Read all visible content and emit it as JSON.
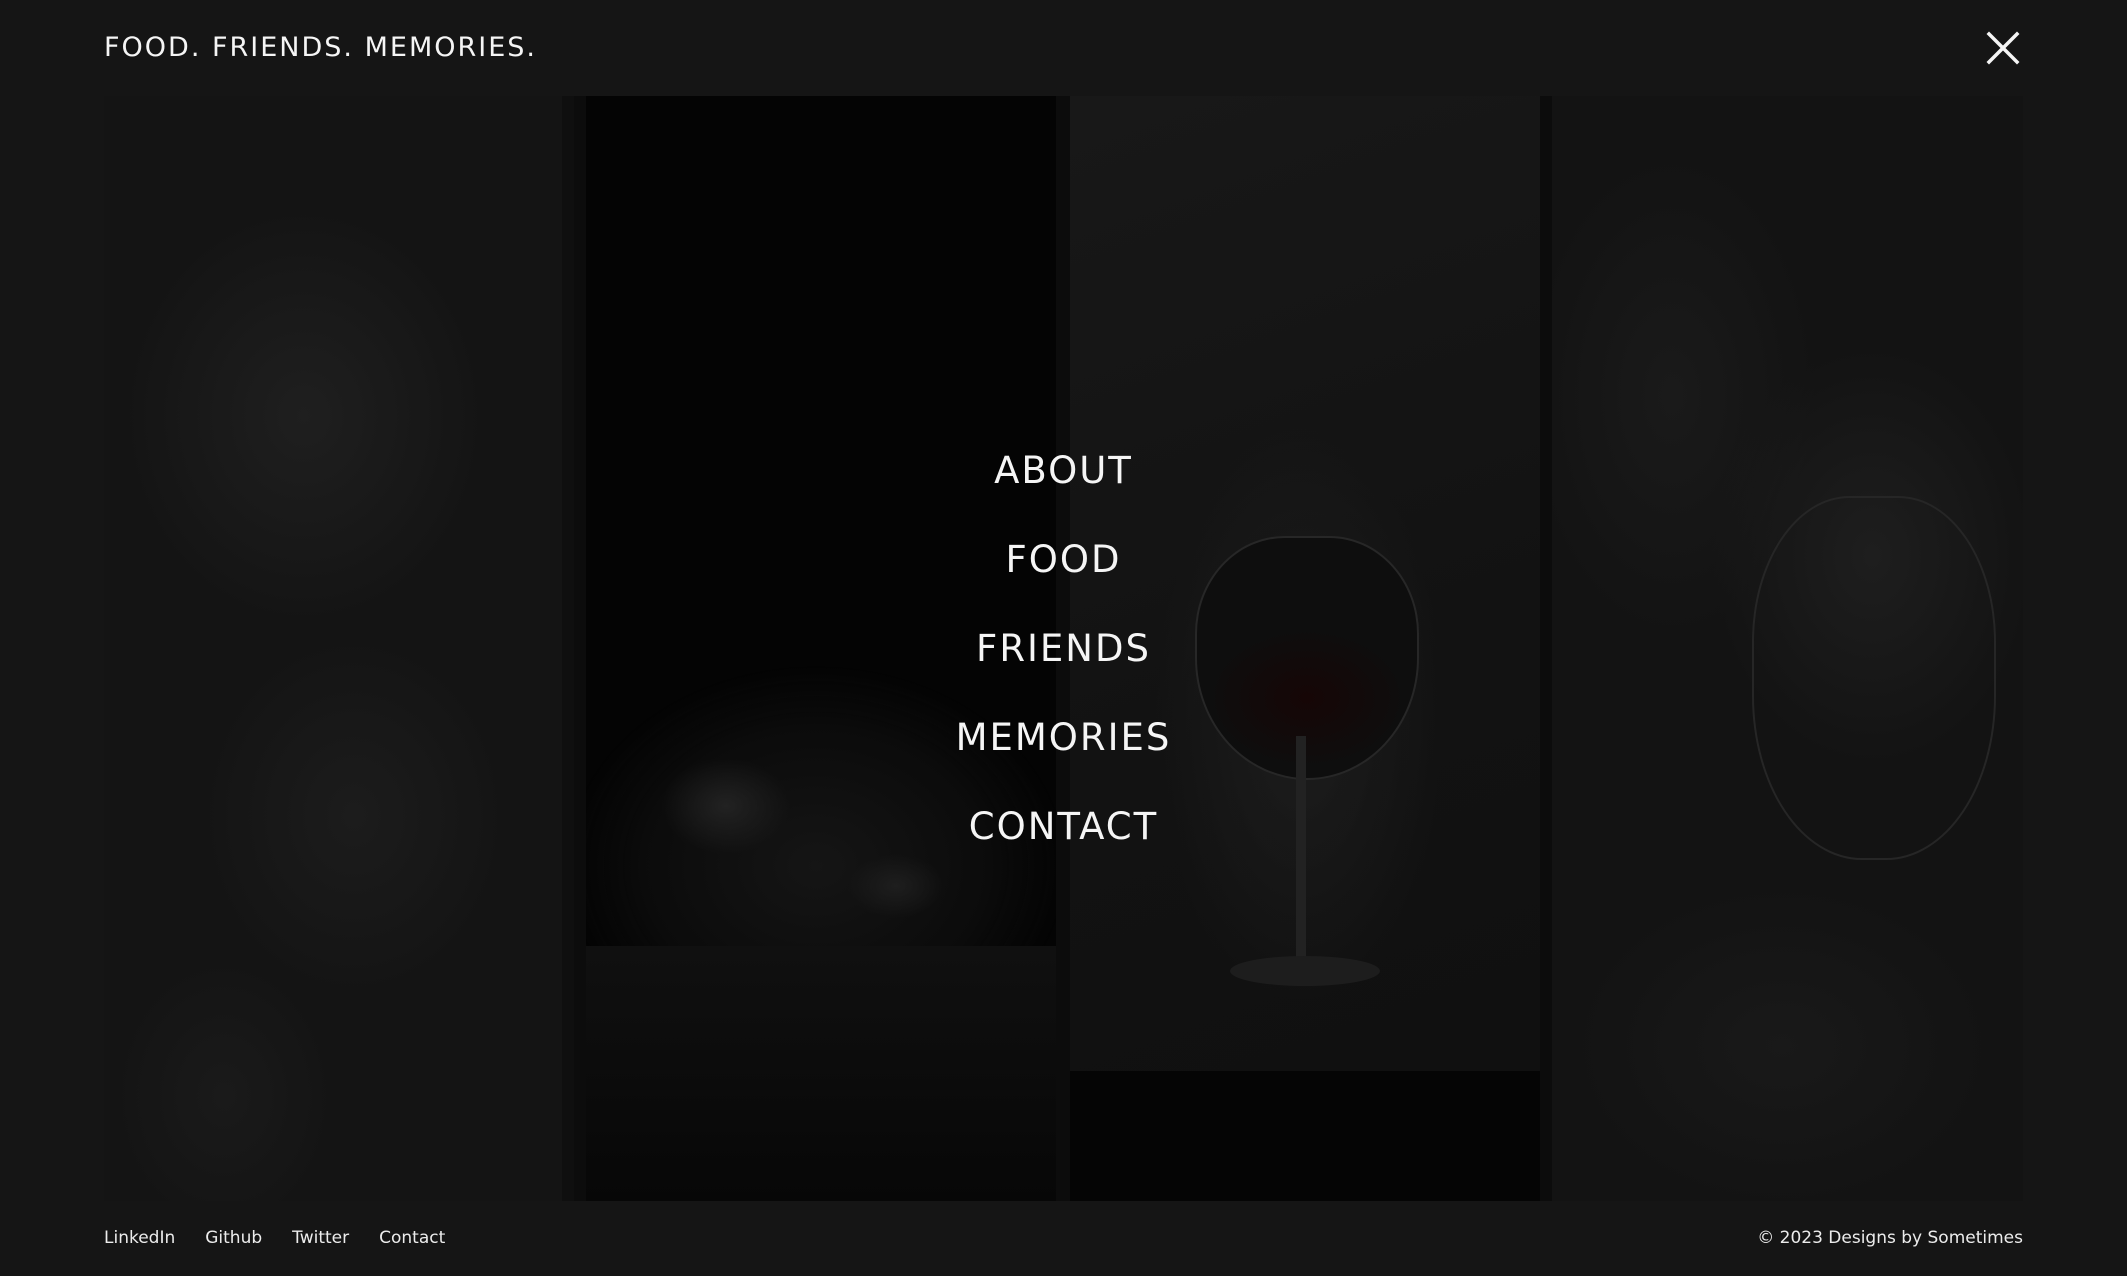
{
  "header": {
    "brand": "FOOD. FRIENDS. MEMORIES.",
    "close_icon": "close-icon"
  },
  "menu": {
    "items": [
      {
        "label": "ABOUT"
      },
      {
        "label": "FOOD"
      },
      {
        "label": "FRIENDS"
      },
      {
        "label": "MEMORIES"
      },
      {
        "label": "CONTACT"
      }
    ]
  },
  "footer": {
    "links": [
      {
        "label": "LinkedIn"
      },
      {
        "label": "Github"
      },
      {
        "label": "Twitter"
      },
      {
        "label": "Contact"
      }
    ],
    "copyright": "© 2023 Designs by Sometimes"
  },
  "colors": {
    "background": "#151515",
    "text": "#f5f5f5"
  }
}
